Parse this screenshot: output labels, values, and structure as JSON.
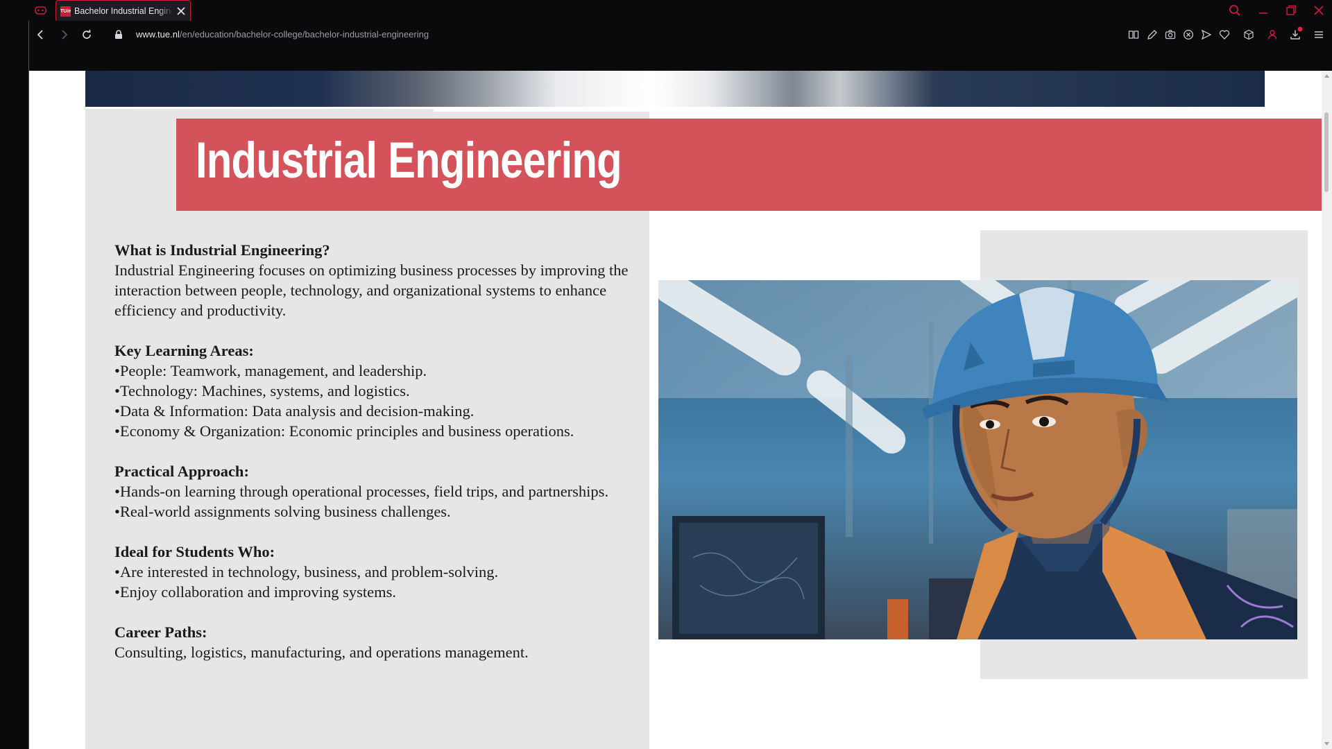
{
  "browser": {
    "tab": {
      "title": "Bachelor Industrial Engineering",
      "favicon_text": "TU/e"
    },
    "url": {
      "host": "www.tue.nl",
      "path": "/en/education/bachelor-college/bachelor-industrial-engineering"
    },
    "icons": [
      "gx-icon",
      "back-icon",
      "forward-icon",
      "reload-icon",
      "lock-icon",
      "search-icon",
      "minimize-icon",
      "restore-icon",
      "close-window-icon",
      "reader-icon",
      "edit-icon",
      "camera-icon",
      "cancel-icon",
      "send-icon",
      "heart-icon",
      "cube-icon",
      "profile-icon",
      "download-icon",
      "menu-icon"
    ],
    "accent_color": "#c91b3a"
  },
  "page": {
    "title": "Industrial Engineering",
    "title_band_color": "#d4525a",
    "sections": [
      {
        "heading": "What is Industrial Engineering?",
        "text": "Industrial Engineering focuses on optimizing business processes by improving the interaction between people, technology, and organizational systems to enhance efficiency and productivity."
      },
      {
        "heading": "Key Learning Areas:",
        "items": [
          "•People: Teamwork, management, and leadership.",
          "•Technology: Machines, systems, and logistics.",
          "•Data & Information: Data analysis and decision-making.",
          "•Economy & Organization: Economic principles and business operations."
        ]
      },
      {
        "heading": "Practical Approach:",
        "items": [
          "•Hands-on learning through operational processes, field trips, and partnerships.",
          "•Real-world assignments solving business challenges."
        ]
      },
      {
        "heading": "Ideal for Students Who:",
        "items": [
          "•Are interested in technology, business, and problem-solving.",
          "•Enjoy collaboration and improving systems."
        ]
      },
      {
        "heading": "Career Paths:",
        "text": "Consulting, logistics, manufacturing, and operations management."
      }
    ]
  }
}
